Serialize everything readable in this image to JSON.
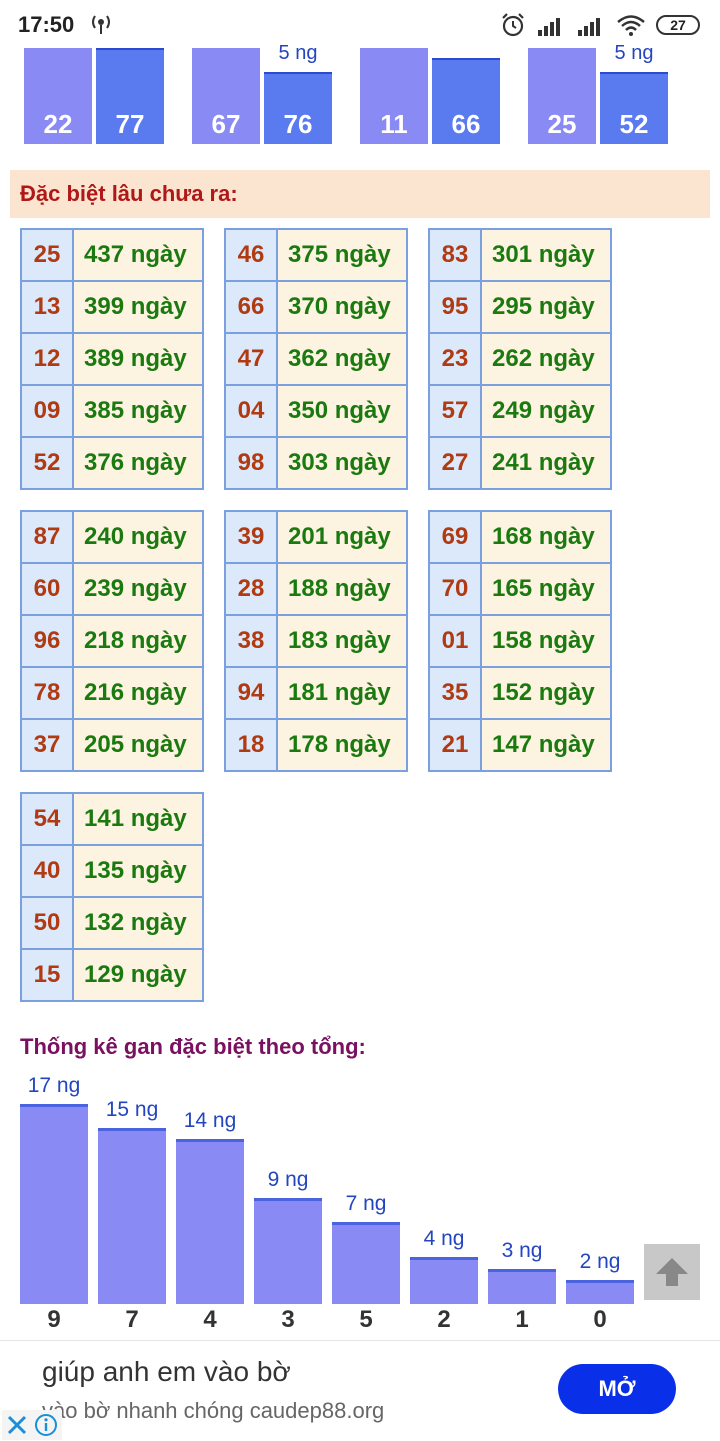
{
  "status_bar": {
    "time": "17:50",
    "battery": "27"
  },
  "top_bars": [
    {
      "values": [
        "22",
        "77"
      ],
      "label": ""
    },
    {
      "values": [
        "67",
        "76"
      ],
      "label": "5 ng"
    },
    {
      "values": [
        "11",
        "66"
      ],
      "label": ""
    },
    {
      "values": [
        "25",
        "52"
      ],
      "label": "5 ng"
    }
  ],
  "section_title": "Đặc biệt lâu chưa ra:",
  "tables": [
    {
      "rows": [
        {
          "num": "25",
          "days": "437 ngày"
        },
        {
          "num": "13",
          "days": "399 ngày"
        },
        {
          "num": "12",
          "days": "389 ngày"
        },
        {
          "num": "09",
          "days": "385 ngày"
        },
        {
          "num": "52",
          "days": "376 ngày"
        }
      ]
    },
    {
      "rows": [
        {
          "num": "46",
          "days": "375 ngày"
        },
        {
          "num": "66",
          "days": "370 ngày"
        },
        {
          "num": "47",
          "days": "362 ngày"
        },
        {
          "num": "04",
          "days": "350 ngày"
        },
        {
          "num": "98",
          "days": "303 ngày"
        }
      ]
    },
    {
      "rows": [
        {
          "num": "83",
          "days": "301 ngày"
        },
        {
          "num": "95",
          "days": "295 ngày"
        },
        {
          "num": "23",
          "days": "262 ngày"
        },
        {
          "num": "57",
          "days": "249 ngày"
        },
        {
          "num": "27",
          "days": "241 ngày"
        }
      ]
    },
    {
      "rows": [
        {
          "num": "87",
          "days": "240 ngày"
        },
        {
          "num": "60",
          "days": "239 ngày"
        },
        {
          "num": "96",
          "days": "218 ngày"
        },
        {
          "num": "78",
          "days": "216 ngày"
        },
        {
          "num": "37",
          "days": "205 ngày"
        }
      ]
    },
    {
      "rows": [
        {
          "num": "39",
          "days": "201 ngày"
        },
        {
          "num": "28",
          "days": "188 ngày"
        },
        {
          "num": "38",
          "days": "183 ngày"
        },
        {
          "num": "94",
          "days": "181 ngày"
        },
        {
          "num": "18",
          "days": "178 ngày"
        }
      ]
    },
    {
      "rows": [
        {
          "num": "69",
          "days": "168 ngày"
        },
        {
          "num": "70",
          "days": "165 ngày"
        },
        {
          "num": "01",
          "days": "158 ngày"
        },
        {
          "num": "35",
          "days": "152 ngày"
        },
        {
          "num": "21",
          "days": "147 ngày"
        }
      ]
    },
    {
      "rows": [
        {
          "num": "54",
          "days": "141 ngày"
        },
        {
          "num": "40",
          "days": "135 ngày"
        },
        {
          "num": "50",
          "days": "132 ngày"
        },
        {
          "num": "15",
          "days": "129 ngày"
        }
      ]
    }
  ],
  "sum_title": "Thống kê gan đặc biệt theo tổng:",
  "chart_data": {
    "type": "bar",
    "categories": [
      "9",
      "7",
      "4",
      "3",
      "5",
      "2",
      "1",
      "0"
    ],
    "values": [
      17,
      15,
      14,
      9,
      7,
      4,
      3,
      2
    ],
    "labels": [
      "17 ng",
      "15 ng",
      "14 ng",
      "9 ng",
      "7 ng",
      "4 ng",
      "3 ng",
      "2 ng"
    ],
    "ylim": [
      0,
      17
    ],
    "colors": {
      "bar": "#8a8af5",
      "bar_top": "#4a64e0",
      "label": "#2346c0"
    }
  },
  "ad": {
    "title": "giúp anh em vào bờ",
    "subtitle": "vào bờ nhanh chóng caudep88.org",
    "button": "MỞ"
  }
}
